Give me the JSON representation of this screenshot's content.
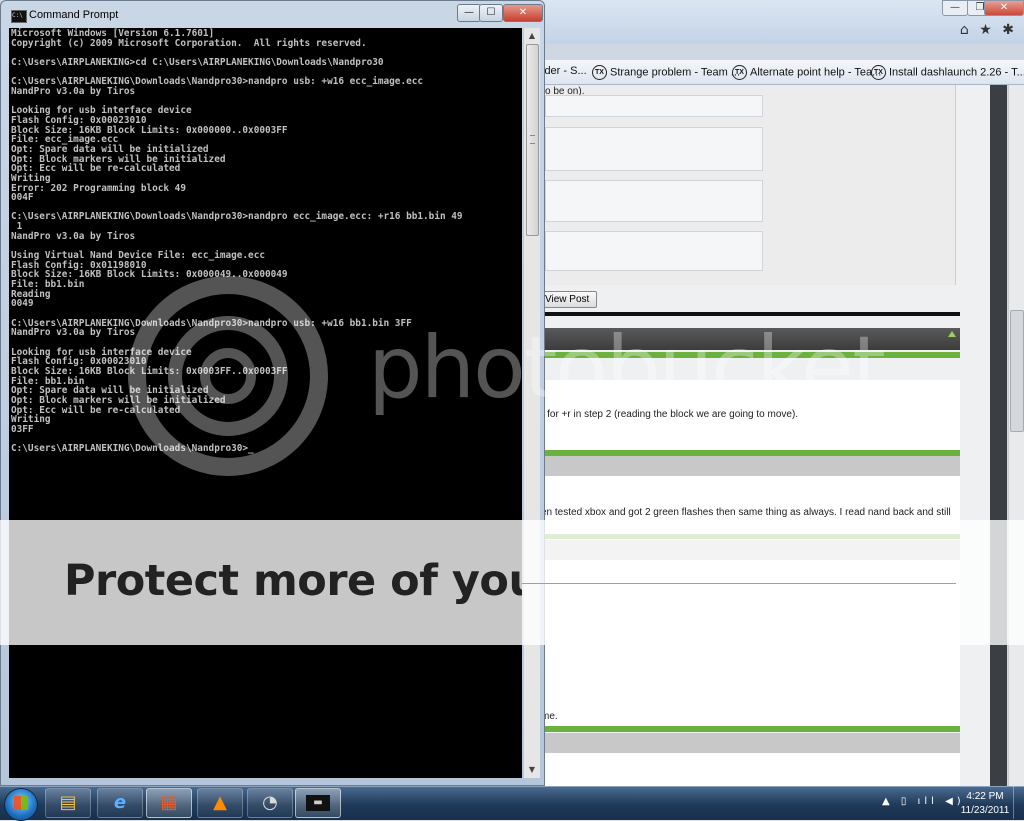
{
  "browser": {
    "favorites": [
      {
        "label": "lder - S..."
      },
      {
        "label": "Strange problem - Team ..."
      },
      {
        "label": "Alternate point help - Tea..."
      },
      {
        "label": "Install dashlaunch 2.26 - T..."
      }
    ],
    "fav_icon_glyph": "TX",
    "posts": {
      "snippet_top": "o be on).",
      "view_post_button": "View Post",
      "snippet_step": "r for +r in step 2 (reading the block we are going to move).",
      "snippet_tested": "en tested xbox and got 2 green flashes then same thing as always. I read nand back and still",
      "snippet_me": "me."
    },
    "window_buttons": {
      "minimize": "—",
      "maximize": "❐",
      "close": "✕"
    },
    "nav_icons": {
      "home": "⌂",
      "favorites": "★",
      "tools": "✱"
    }
  },
  "cmd": {
    "title": "Command Prompt",
    "icon_text": "C:\\",
    "buttons": {
      "minimize": "—",
      "maximize": "☐",
      "close": "✕"
    },
    "lines": [
      "Microsoft Windows [Version 6.1.7601]",
      "Copyright (c) 2009 Microsoft Corporation.  All rights reserved.",
      "",
      "C:\\Users\\AIRPLANEKING>cd C:\\Users\\AIRPLANEKING\\Downloads\\Nandpro30",
      "",
      "C:\\Users\\AIRPLANEKING\\Downloads\\Nandpro30>nandpro usb: +w16 ecc_image.ecc",
      "NandPro v3.0a by Tiros",
      "",
      "Looking for usb interface device",
      "Flash Config: 0x00023010",
      "Block Size: 16KB Block Limits: 0x000000..0x0003FF",
      "File: ecc_image.ecc",
      "Opt: Spare data will be initialized",
      "Opt: Block markers will be initialized",
      "Opt: Ecc will be re-calculated",
      "Writing",
      "Error: 202 Programming block 49",
      "004F",
      "",
      "C:\\Users\\AIRPLANEKING\\Downloads\\Nandpro30>nandpro ecc_image.ecc: +r16 bb1.bin 49",
      " 1",
      "NandPro v3.0a by Tiros",
      "",
      "Using Virtual Nand Device File: ecc_image.ecc",
      "Flash Config: 0x01198010",
      "Block Size: 16KB Block Limits: 0x000049..0x000049",
      "File: bb1.bin",
      "Reading",
      "0049",
      "",
      "C:\\Users\\AIRPLANEKING\\Downloads\\Nandpro30>nandpro usb: +w16 bb1.bin 3FF",
      "NandPro v3.0a by Tiros",
      "",
      "Looking for usb interface device",
      "Flash Config: 0x00023010",
      "Block Size: 16KB Block Limits: 0x0003FF..0x0003FF",
      "File: bb1.bin",
      "Opt: Spare data will be initialized",
      "Opt: Block markers will be initialized",
      "Opt: Ecc will be re-calculated",
      "Writing",
      "03FF",
      "",
      "C:\\Users\\AIRPLANEKING\\Downloads\\Nandpro30>_"
    ],
    "scroll_arrows": {
      "up": "▲",
      "down": "▼"
    }
  },
  "watermark": {
    "text": "photobucket"
  },
  "banner": {
    "text": "Protect more of your"
  },
  "taskbar": {
    "apps": [
      {
        "name": "windows-explorer",
        "glyph": "▤"
      },
      {
        "name": "internet-explorer",
        "glyph": "e"
      },
      {
        "name": "paint",
        "glyph": "▦"
      },
      {
        "name": "vlc",
        "glyph": "▲"
      },
      {
        "name": "app-5",
        "glyph": "◔"
      },
      {
        "name": "command-prompt",
        "glyph": "▬"
      }
    ],
    "tray_icons": "▲ ▯ ıll ◀)",
    "clock_time": "4:22 PM",
    "clock_date": "11/23/2011"
  },
  "colors": {
    "console_bg": "#000000",
    "console_text": "#c0c0c0",
    "forum_green": "#6bb13d"
  }
}
